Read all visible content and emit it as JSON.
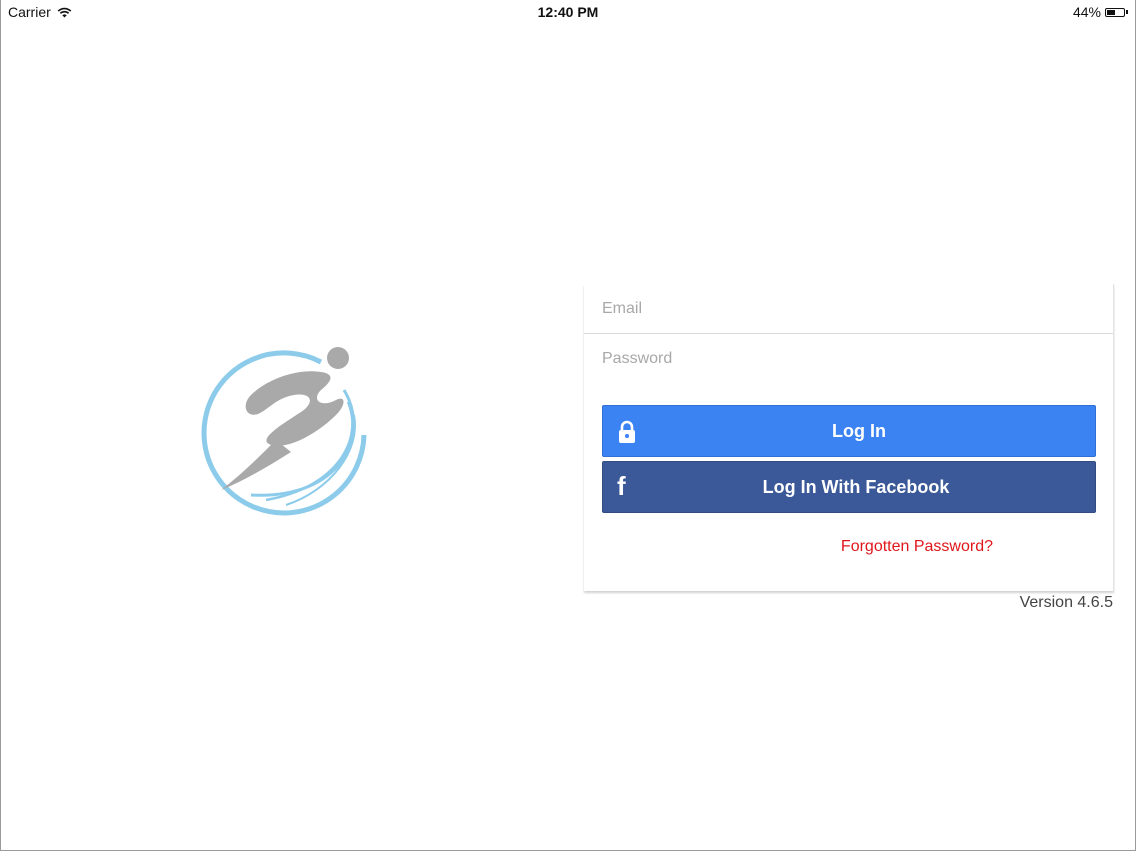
{
  "status_bar": {
    "carrier": "Carrier",
    "time": "12:40 PM",
    "battery_percent": "44%",
    "battery_level": 0.44
  },
  "login": {
    "email_placeholder": "Email",
    "password_placeholder": "Password",
    "login_label": "Log In",
    "facebook_label": "Log In With Facebook",
    "forgot_label": "Forgotten Password?"
  },
  "footer": {
    "version": "Version 4.6.5"
  },
  "colors": {
    "login_button": "#3b82f2",
    "facebook_button": "#3b5998",
    "forgot_link": "#e0161c",
    "logo_ring": "#8ccbea",
    "logo_figure": "#a9a9a9"
  },
  "icons": {
    "login_icon": "lock-icon",
    "facebook_icon": "facebook-icon",
    "wifi": "wifi-icon",
    "battery": "battery-icon"
  }
}
